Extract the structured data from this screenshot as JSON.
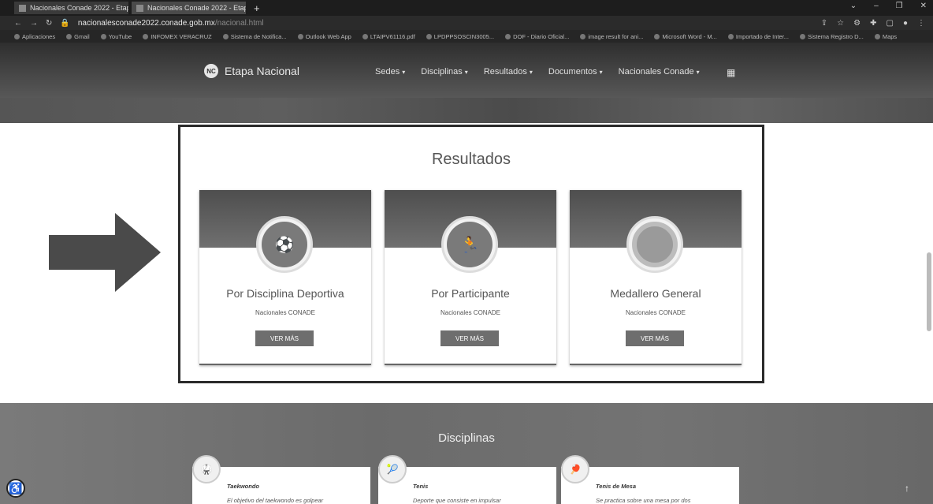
{
  "browser": {
    "tabs": [
      {
        "label": "Nacionales Conade 2022 - Etapa"
      },
      {
        "label": "Nacionales Conade 2022 - Etapa"
      }
    ],
    "url": "nacionalesconade2022.conade.gob.mx",
    "url_suffix": "/nacional.html",
    "bookmarks": [
      "Aplicaciones",
      "Gmail",
      "YouTube",
      "INFOMEX VERACRUZ",
      "Sistema de Notifica...",
      "Outlook Web App",
      "LTAIPV61116.pdf",
      "LPDPPSOSCIN3005...",
      "DOF - Diario Oficial...",
      "image result for ani...",
      "Microsoft Word - M...",
      "Importado de Inter...",
      "Sistema Registro D...",
      "Maps"
    ]
  },
  "site": {
    "logo_text": "NC",
    "brand": "Etapa Nacional",
    "menu": [
      "Sedes",
      "Disciplinas",
      "Resultados",
      "Documentos",
      "Nacionales Conade"
    ],
    "grid_icon": "grid-icon"
  },
  "results": {
    "title": "Resultados",
    "cards": [
      {
        "title": "Por Disciplina Deportiva",
        "subtitle": "Nacionales CONADE",
        "button": "VER MÁS",
        "icon": "sports-balls-icon"
      },
      {
        "title": "Por Participante",
        "subtitle": "Nacionales CONADE",
        "button": "VER MÁS",
        "icon": "athlete-bib-icon"
      },
      {
        "title": "Medallero General",
        "subtitle": "Nacionales CONADE",
        "button": "VER MÁS",
        "icon": "medal-icon"
      }
    ]
  },
  "disciplinas": {
    "title": "Disciplinas",
    "items": [
      {
        "name": "Taekwondo",
        "text": "El objetivo del taekwondo es golpear"
      },
      {
        "name": "Tenis",
        "text": "Deporte que consiste en impulsar"
      },
      {
        "name": "Tenis de Mesa",
        "text": "Se practica sobre una mesa por dos"
      }
    ]
  }
}
